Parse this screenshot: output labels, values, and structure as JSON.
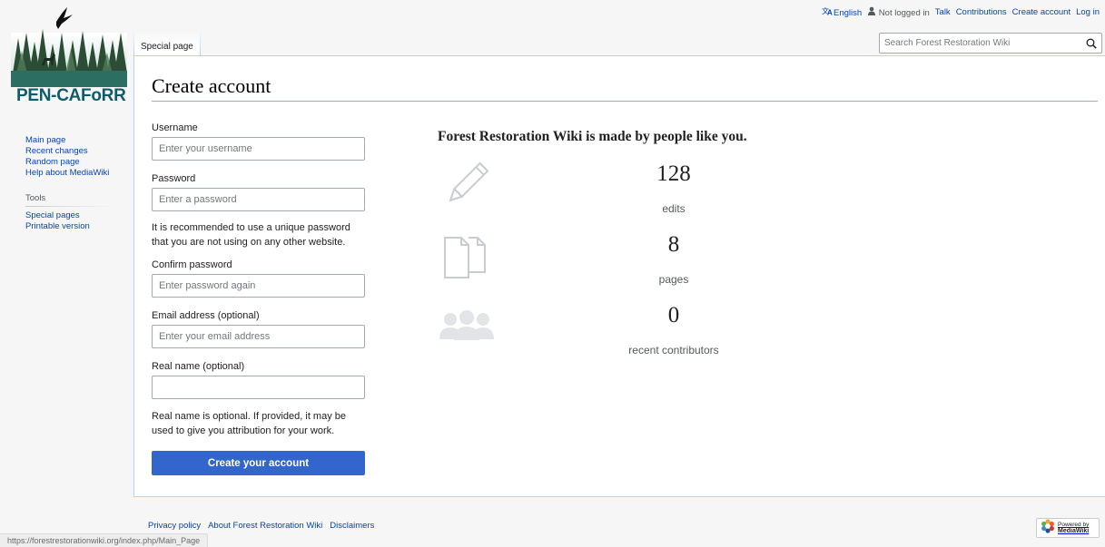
{
  "personal_tools": {
    "language": "English",
    "not_logged_in": "Not logged in",
    "talk": "Talk",
    "contributions": "Contributions",
    "create_account": "Create account",
    "log_in": "Log in"
  },
  "logo": {
    "text": "PEN-CAFoRR"
  },
  "sidebar": {
    "nav": [
      "Main page",
      "Recent changes",
      "Random page",
      "Help about MediaWiki"
    ],
    "tools_heading": "Tools",
    "tools": [
      "Special pages",
      "Printable version"
    ]
  },
  "tabs": {
    "special_page": "Special page"
  },
  "search": {
    "placeholder": "Search Forest Restoration Wiki"
  },
  "page": {
    "title": "Create account"
  },
  "form": {
    "username_label": "Username",
    "username_placeholder": "Enter your username",
    "password_label": "Password",
    "password_placeholder": "Enter a password",
    "password_help": "It is recommended to use a unique password that you are not using on any other website.",
    "confirm_label": "Confirm password",
    "confirm_placeholder": "Enter password again",
    "email_label": "Email address (optional)",
    "email_placeholder": "Enter your email address",
    "realname_label": "Real name (optional)",
    "realname_placeholder": "",
    "realname_help": "Real name is optional. If provided, it may be used to give you attribution for your work.",
    "submit_label": "Create your account"
  },
  "benefits": {
    "heading": "Forest Restoration Wiki is made by people like you.",
    "stats": [
      {
        "icon": "pencil-icon",
        "value": "128",
        "label": "edits"
      },
      {
        "icon": "pages-icon",
        "value": "8",
        "label": "pages"
      },
      {
        "icon": "users-icon",
        "value": "0",
        "label": "recent contributors"
      }
    ]
  },
  "footer": {
    "links": [
      "Privacy policy",
      "About Forest Restoration Wiki",
      "Disclaimers"
    ],
    "powered_by_line1": "Powered by",
    "powered_by_line2": "MediaWiki"
  },
  "status_bar": {
    "url": "https://forestrestorationwiki.org/index.php/Main_Page"
  },
  "colors": {
    "link": "#0645ad",
    "primary_button": "#3366cc",
    "logo_text": "#0e5c6b"
  }
}
